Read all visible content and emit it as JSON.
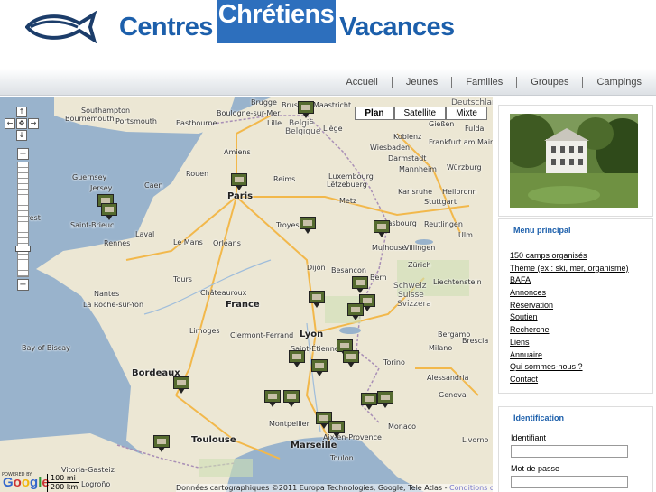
{
  "header": {
    "brand_1": "Centres",
    "brand_2": "Chrétiens",
    "brand_3": "Vacances",
    "logo_icon": "ichthys-fish-icon"
  },
  "nav": {
    "items": [
      "Accueil",
      "Jeunes",
      "Familles",
      "Groupes",
      "Campings"
    ]
  },
  "map": {
    "type_buttons": [
      "Plan",
      "Satellite",
      "Mixte"
    ],
    "active_type": "Plan",
    "zoom_in": "+",
    "zoom_out": "−",
    "labels": {
      "southampton": "Southampton",
      "bournemouth": "Bournemouth",
      "portsmouth": "Portsmouth",
      "eastbourne": "Eastbourne",
      "boulogne": "Boulogne-sur-Mer",
      "brugge": "Brugge",
      "brussel": "Brussel",
      "maastricht": "Maastricht",
      "belgie": "België",
      "belgique": "Belgique",
      "liege": "Liège",
      "deutschland": "Deutschland",
      "giessen": "Gießen",
      "fulda": "Fulda",
      "koblenz": "Koblenz",
      "wiesbaden": "Wiesbaden",
      "frankfurt": "Frankfurt am Main",
      "darmstadt": "Darmstadt",
      "mannheim": "Mannheim",
      "wurzburg": "Würzburg",
      "amiens": "Amiens",
      "lille": "Lille",
      "rouen": "Rouen",
      "caen": "Caen",
      "guernsey": "Guernsey",
      "jersey": "Jersey",
      "paris": "Paris",
      "reims": "Reims",
      "luxembourg": "Luxembourg",
      "letzebuerg": "Lëtzebuerg",
      "metz": "Metz",
      "karlsruhe": "Karlsruhe",
      "heilbronn": "Heilbronn",
      "stuttgart": "Stuttgart",
      "strasbourg": "Strasbourg",
      "reutlingen": "Reutlingen",
      "ulm": "Ulm",
      "brest": "Brest",
      "rennes": "Rennes",
      "laval": "Laval",
      "lemans": "Le Mans",
      "orleans": "Orléans",
      "troyes": "Troyes",
      "saintbrieuc": "Saint-Brieuc",
      "dijon": "Dijon",
      "besancon": "Besançon",
      "mulhouse": "Mulhouse",
      "villingen": "Villingen",
      "zurich": "Zürich",
      "bern": "Bern",
      "schweiz": "Schweiz",
      "suisse": "Suisse",
      "svizzera": "Svizzera",
      "liechtenstein": "Liechtenstein",
      "nantes": "Nantes",
      "tours": "Tours",
      "chateauroux": "Châteauroux",
      "france": "France",
      "larochesuryon": "La Roche-sur-Yon",
      "limoges": "Limoges",
      "clermont": "Clermont-Ferrand",
      "lyon": "Lyon",
      "saintetienne": "Saint-Étienne",
      "bayofbiscay": "Bay of Biscay",
      "bordeaux": "Bordeaux",
      "torino": "Torino",
      "milano": "Milano",
      "alessandria": "Alessandria",
      "genova": "Genova",
      "bergamo": "Bergamo",
      "brescia": "Brescia",
      "montpellier": "Montpellier",
      "marseille": "Marseille",
      "toulon": "Toulon",
      "toulouse": "Toulouse",
      "aixenprovence": "Aix-en-Provence",
      "monaco": "Monaco",
      "livorno": "Livorno",
      "vitoria": "Vitoria-Gasteiz",
      "logrono": "Logroño"
    },
    "scale_top": "100 mi",
    "scale_bottom": "200 km",
    "powered_by": "POWERED BY",
    "google_logo": "Google",
    "copyright": "Données cartographiques ©2011 Europa Technologies, Google, Tele Atlas -",
    "terms_link": "Conditions d'utilisation"
  },
  "sidebar": {
    "menu_title": "Menu principal",
    "menu_items": [
      "150 camps organisés",
      "Thème (ex : ski, mer, organisme)",
      "BAFA",
      "Annonces",
      "Réservation",
      "Soutien",
      "Recherche",
      "Liens",
      "Annuaire",
      "Qui sommes-nous ?",
      "Contact"
    ],
    "login_title": "Identification",
    "login_label": "Identifiant",
    "password_label": "Mot de passe"
  }
}
